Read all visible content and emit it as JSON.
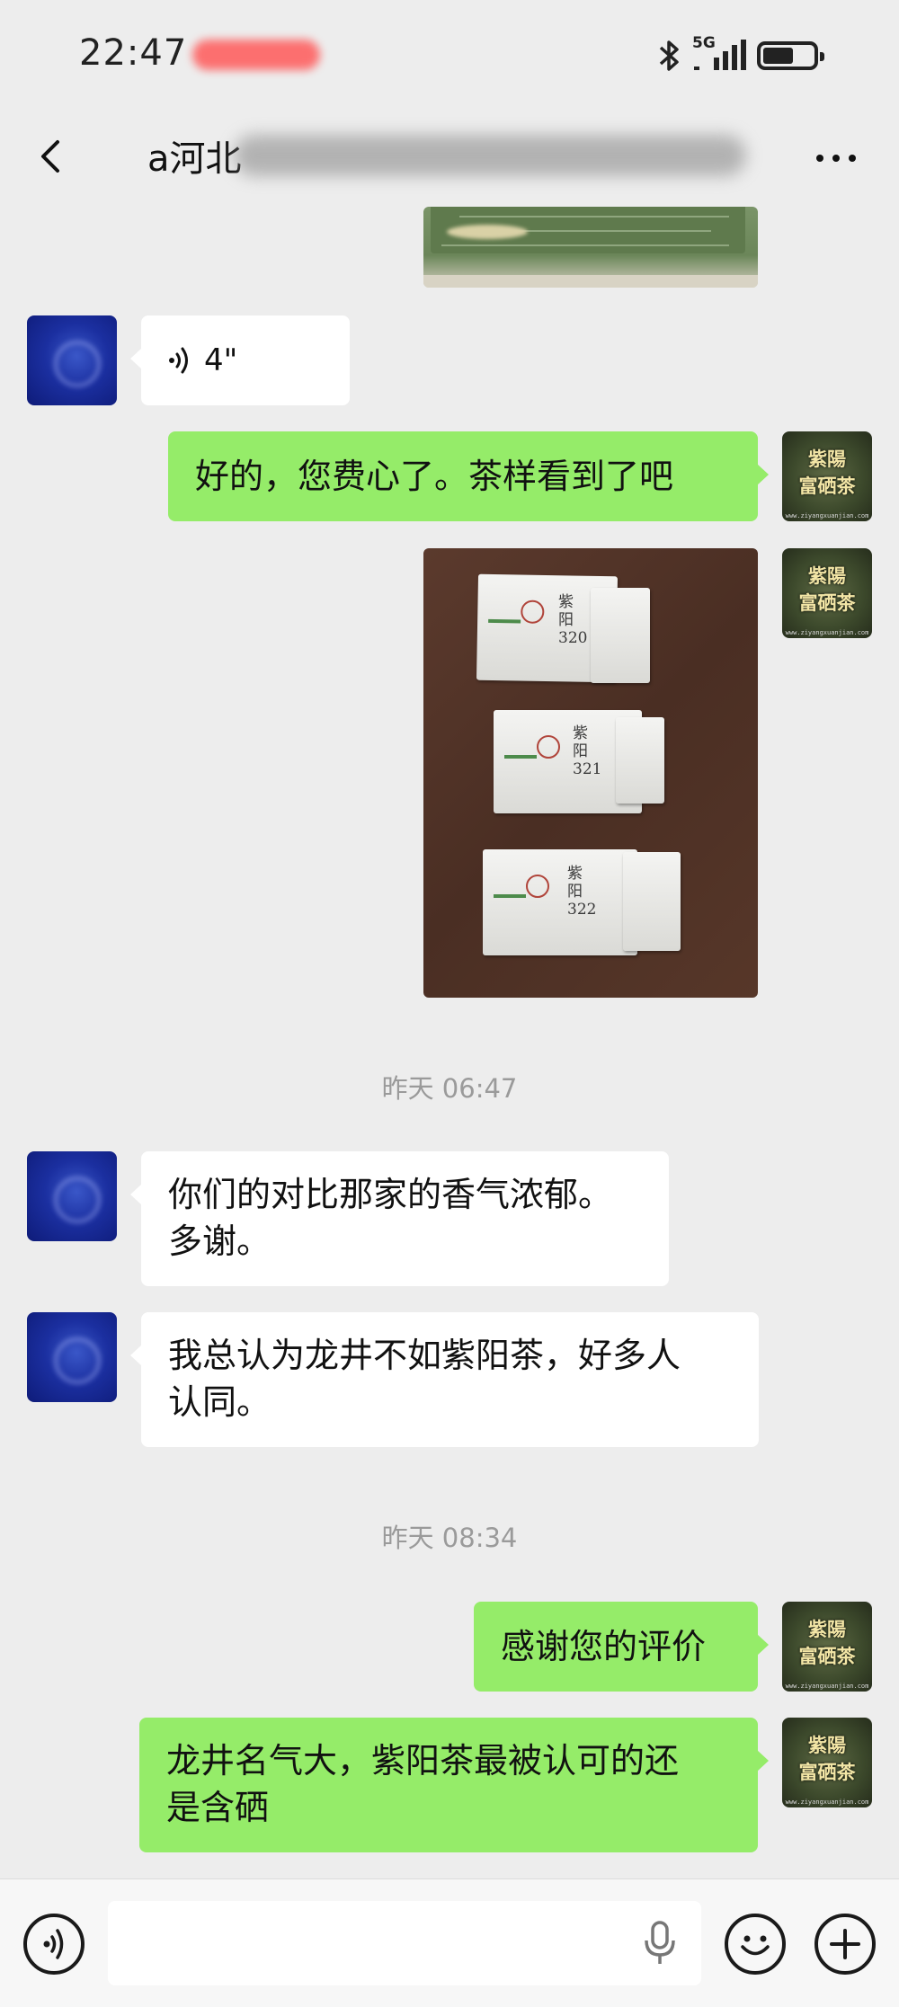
{
  "status_bar": {
    "time": "22:47",
    "network": "5G",
    "icons": [
      "bluetooth-icon",
      "signal-icon",
      "battery-icon"
    ],
    "battery_level": 0.62
  },
  "header": {
    "title": "a河北",
    "back_icon": "chevron-left-icon",
    "more_icon": "more-dots-icon"
  },
  "messages": {
    "voice": {
      "duration": "4\""
    },
    "m1": "好的，您费心了。茶样看到了吧",
    "sachet_labels": [
      "紫阳320",
      "紫阳321",
      "紫阳322"
    ],
    "ts1": "昨天 06:47",
    "m2_line1": "你们的对比那家的香气浓郁。",
    "m2_line2": "多谢。",
    "m3_line1": "我总认为龙井不如紫阳茶，好多人",
    "m3_line2": "认同。",
    "ts2": "昨天 08:34",
    "m4": "感谢您的评价",
    "m5_line1": "龙井名气大，紫阳茶最被认可的还",
    "m5_line2": "是含硒"
  },
  "self_avatar": {
    "brand_line1": "紫陽",
    "brand_line2": "富硒茶",
    "url": "www.ziyangxuanjian.com"
  },
  "input_bar": {
    "value": "",
    "icons": [
      "voice-mode-icon",
      "mic-icon",
      "emoji-icon",
      "plus-icon"
    ]
  },
  "colors": {
    "background": "#ededed",
    "self_bubble": "#95ec69",
    "other_bubble": "#ffffff",
    "timestamp": "#9a9a9a"
  }
}
